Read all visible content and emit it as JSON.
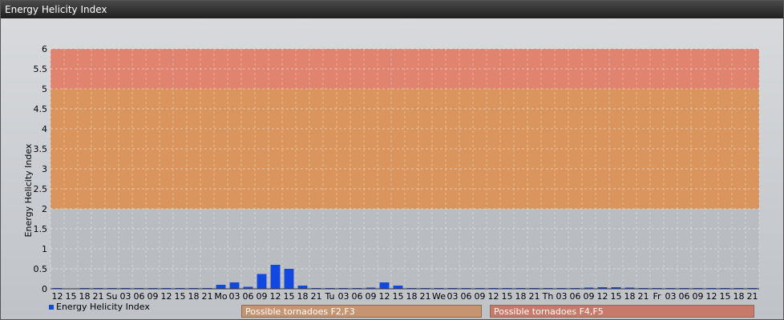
{
  "window_title": "Energy Helicity Index",
  "legend_label": "Energy Helicity Index",
  "band_labels": [
    "Possible tornadoes F2,F3",
    "Possible tornadoes F4,F5"
  ],
  "colors": {
    "bar": "#1148e0",
    "band_low": "#d9955d",
    "band_high": "#e0836f",
    "band_label_1": "#c69471",
    "band_label_2": "#c77a6a"
  },
  "chart_data": {
    "type": "bar",
    "title": "",
    "ylabel": "Energy Helicity Index",
    "ylim": [
      0,
      6
    ],
    "yticks": [
      "0",
      "0.5",
      "1",
      "1.5",
      "2",
      "2.5",
      "3",
      "3.5",
      "4",
      "4.5",
      "5",
      "5.5",
      "6"
    ],
    "bands": [
      {
        "from": 2,
        "to": 5,
        "label": "Possible tornadoes F2,F3"
      },
      {
        "from": 5,
        "to": 6,
        "label": "Possible tornadoes F4,F5"
      }
    ],
    "grid": true,
    "legend_position": "bottom-left",
    "categories": [
      "12",
      "15",
      "18",
      "21",
      "Su",
      "03",
      "06",
      "09",
      "12",
      "15",
      "18",
      "21",
      "Mo",
      "03",
      "06",
      "09",
      "12",
      "15",
      "18",
      "21",
      "Tu",
      "03",
      "06",
      "09",
      "12",
      "15",
      "18",
      "21",
      "We",
      "03",
      "06",
      "09",
      "12",
      "15",
      "18",
      "21",
      "Th",
      "03",
      "06",
      "09",
      "12",
      "15",
      "18",
      "21",
      "Fr",
      "03",
      "06",
      "09",
      "12",
      "15",
      "18",
      "21"
    ],
    "series": [
      {
        "name": "Energy Helicity Index",
        "values": [
          0.02,
          0.01,
          0.02,
          0.02,
          0.02,
          0.02,
          0.02,
          0.02,
          0.02,
          0.02,
          0.02,
          0.02,
          0.1,
          0.16,
          0.05,
          0.37,
          0.6,
          0.5,
          0.08,
          0.02,
          0.02,
          0.02,
          0.02,
          0.03,
          0.16,
          0.08,
          0.02,
          0.02,
          0.02,
          0.02,
          0.02,
          0.02,
          0.02,
          0.02,
          0.02,
          0.02,
          0.02,
          0.02,
          0.02,
          0.03,
          0.04,
          0.04,
          0.03,
          0.02,
          0.02,
          0.02,
          0.02,
          0.02,
          0.02,
          0.02,
          0.02,
          0.02
        ]
      }
    ]
  }
}
